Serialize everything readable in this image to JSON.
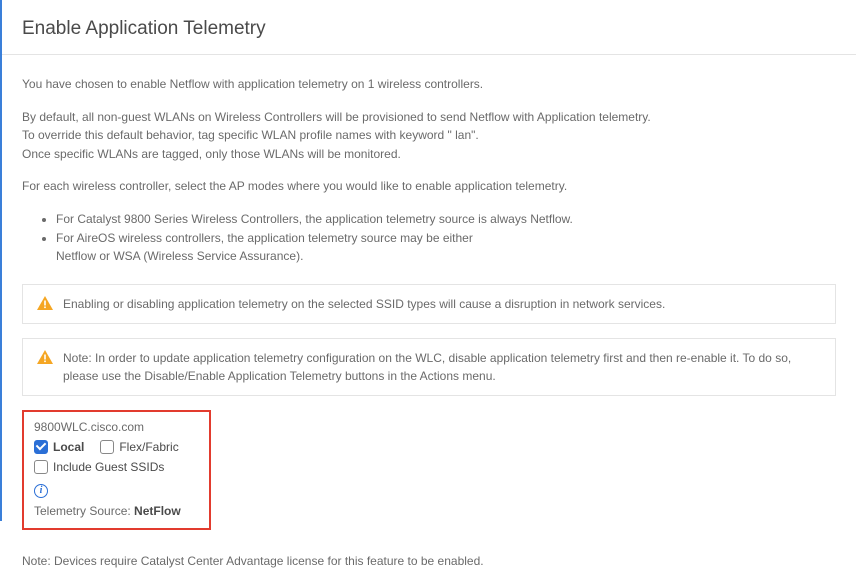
{
  "title": "Enable Application Telemetry",
  "intro": {
    "p1": "You have chosen to enable Netflow with application telemetry on 1 wireless controllers.",
    "p2a": "By default, all non-guest WLANs on Wireless Controllers will be provisioned to send Netflow with Application telemetry.",
    "p2b": "To override this default behavior, tag specific WLAN profile names with keyword \" lan\".",
    "p2c": "Once specific WLANs are tagged, only those WLANs will be monitored.",
    "p3": "For each wireless controller, select the AP modes where you would like to enable application telemetry."
  },
  "bullets": [
    "For Catalyst 9800 Series Wireless Controllers, the application telemetry source is always Netflow.",
    "For AireOS wireless controllers, the application telemetry source may be either",
    "Netflow or WSA (Wireless Service Assurance)."
  ],
  "alerts": {
    "a1": "Enabling or disabling application telemetry on the selected SSID types will cause a disruption in network services.",
    "a2": "Note: In order to update application telemetry configuration on the WLC, disable application telemetry first and then re-enable it. To do so, please use the Disable/Enable Application Telemetry buttons in the Actions menu."
  },
  "device": {
    "name": "9800WLC.cisco.com",
    "local_label": "Local",
    "flex_label": "Flex/Fabric",
    "include_guest_label": "Include Guest SSIDs",
    "source_label": "Telemetry Source: ",
    "source_value": "NetFlow"
  },
  "footer": "Note: Devices require Catalyst Center Advantage license for this feature to be enabled."
}
